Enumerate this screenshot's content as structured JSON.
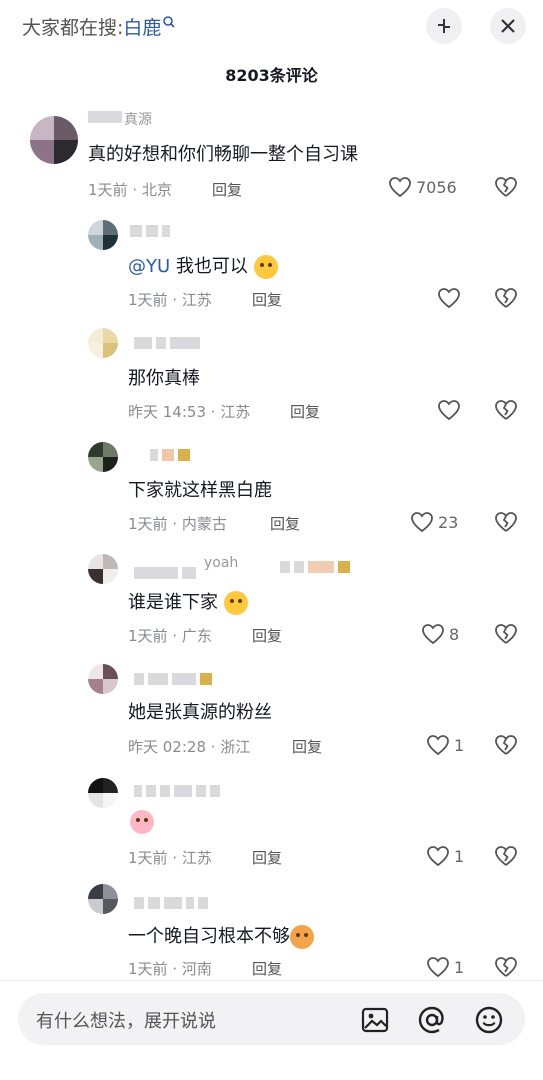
{
  "header": {
    "search_prefix": "大家都在搜:",
    "search_keyword": "白鹿",
    "comment_count": "8203条评论"
  },
  "comments": [
    {
      "partial_name": "真源",
      "content": "真的好想和你们畅聊一整个自习课",
      "time": "1天前",
      "location": "北京",
      "reply": "回复",
      "likes": "7056"
    },
    {
      "mention": "@YU",
      "content": "我也可以",
      "time": "1天前",
      "location": "江苏",
      "reply": "回复",
      "likes": ""
    },
    {
      "content": "那你真棒",
      "time": "昨天 14:53",
      "location": "江苏",
      "reply": "回复",
      "likes": ""
    },
    {
      "content": "下家就这样黑白鹿",
      "time": "1天前",
      "location": "内蒙古",
      "reply": "回复",
      "likes": "23"
    },
    {
      "partial_name": "yoah",
      "content": "谁是谁下家",
      "time": "1天前",
      "location": "广东",
      "reply": "回复",
      "likes": "8"
    },
    {
      "content": "她是张真源的粉丝",
      "time": "昨天 02:28",
      "location": "浙江",
      "reply": "回复",
      "likes": "1"
    },
    {
      "content": "",
      "time": "1天前",
      "location": "江苏",
      "reply": "回复",
      "likes": "1"
    },
    {
      "content": "一个晚自习根本不够",
      "time": "1天前",
      "location": "河南",
      "reply": "回复",
      "likes": "1"
    }
  ],
  "input": {
    "placeholder": "有什么想法，展开说说"
  },
  "icons": {
    "collapse": "collapse-icon",
    "close": "close-icon",
    "like": "heart-icon",
    "dislike": "broken-heart-icon",
    "image": "image-icon",
    "mention": "at-icon",
    "emoji": "emoji-icon"
  }
}
